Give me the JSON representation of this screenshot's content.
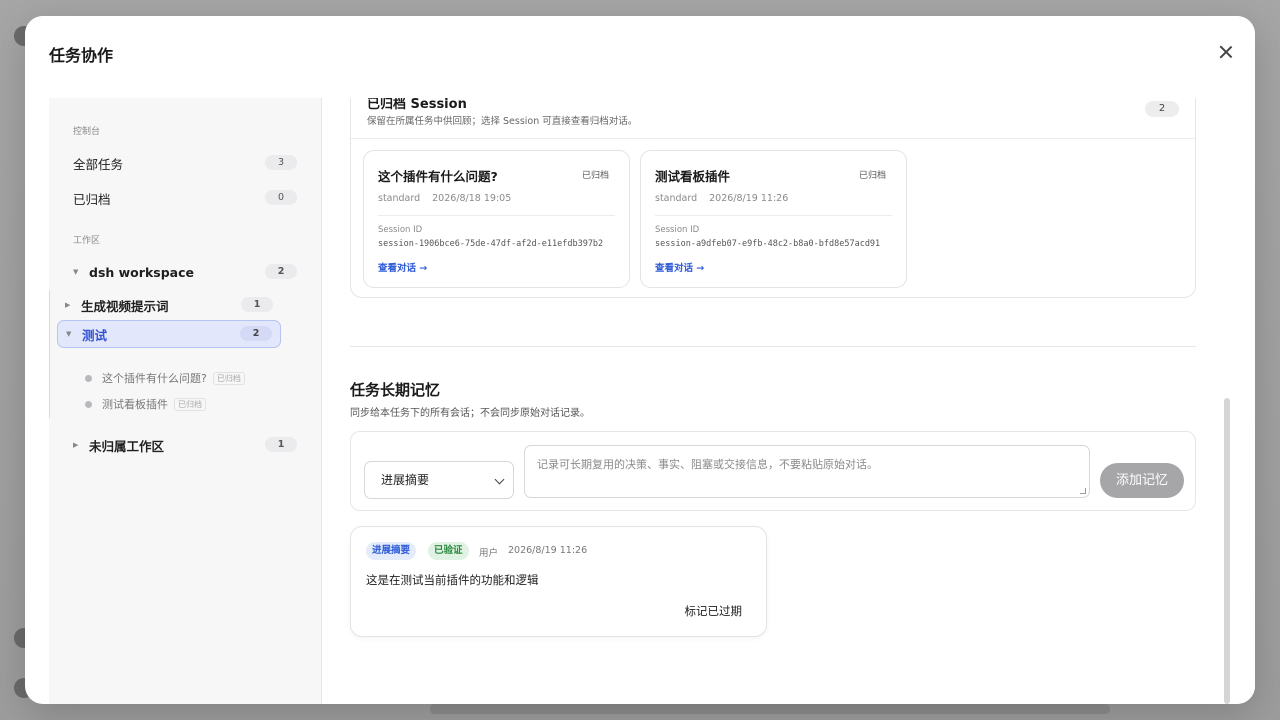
{
  "modal": {
    "title": "任务协作"
  },
  "sidebar": {
    "console_label": "控制台",
    "items": [
      {
        "label": "全部任务",
        "count": "3"
      },
      {
        "label": "已归档",
        "count": "0"
      }
    ],
    "workspace_label": "工作区",
    "workspaces": [
      {
        "label": "dsh workspace",
        "count": "2"
      },
      {
        "label": "生成视频提示词",
        "count": "1"
      },
      {
        "label": "测试",
        "count": "2"
      },
      {
        "label": "未归属工作区",
        "count": "1"
      }
    ],
    "sessions": [
      {
        "label": "这个插件有什么问题?",
        "tag": "已归档"
      },
      {
        "label": "测试看板插件",
        "tag": "已归档"
      }
    ]
  },
  "archived": {
    "title": "已归档 Session",
    "description": "保留在所属任务中供回顾；选择 Session 可直接查看归档对话。",
    "count": "2",
    "cards": [
      {
        "title": "这个插件有什么问题?",
        "status": "已归档",
        "mode": "standard",
        "time": "2026/8/18 19:05",
        "id_label": "Session ID",
        "id_value": "session-1906bce6-75de-47df-af2d-e11efdb397b2",
        "link": "查看对话 →"
      },
      {
        "title": "测试看板插件",
        "status": "已归档",
        "mode": "standard",
        "time": "2026/8/19 11:26",
        "id_label": "Session ID",
        "id_value": "session-a9dfeb07-e9fb-48c2-b8a0-bfd8e57acd91",
        "link": "查看对话 →"
      }
    ]
  },
  "memory": {
    "title": "任务长期记忆",
    "description": "同步给本任务下的所有会话；不会同步原始对话记录。",
    "select_value": "进展摘要",
    "textarea_placeholder": "记录可长期复用的决策、事实、阻塞或交接信息，不要粘贴原始对话。",
    "add_button": "添加记忆",
    "entries": [
      {
        "type_tag": "进展摘要",
        "verified_tag": "已验证",
        "author": "用户",
        "time": "2026/8/19 11:26",
        "text": "这是在测试当前插件的功能和逻辑",
        "expire_action": "标记已过期"
      }
    ]
  },
  "colors": {
    "accent": "#2d5bd7",
    "active_bg": "#e3e7fb",
    "verified": "#2b8a3e"
  }
}
